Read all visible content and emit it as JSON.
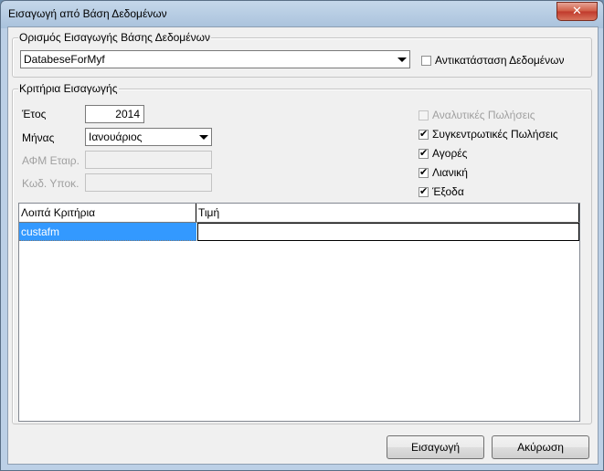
{
  "window": {
    "title": "Εισαγωγή από Βάση Δεδομένων"
  },
  "db_group": {
    "label": "Ορισμός Εισαγωγής Βάσης Δεδομένων",
    "database_value": "DatabeseForMyf",
    "replace_label": "Αντικατάσταση Δεδομένων",
    "replace_checked": false
  },
  "criteria_group": {
    "label": "Κριτήρια Εισαγωγής",
    "year_label": "Έτος",
    "year_value": "2014",
    "month_label": "Μήνας",
    "month_value": "Ιανουάριος",
    "afm_label": "ΑΦΜ Εταιρ.",
    "afm_value": "",
    "branch_label": "Κωδ. Υποκ.",
    "branch_value": "",
    "checkboxes": [
      {
        "label": "Αναλυτικές Πωλήσεις",
        "checked": false,
        "enabled": false
      },
      {
        "label": "Συγκεντρωτικές Πωλήσεις",
        "checked": true,
        "enabled": true
      },
      {
        "label": "Αγορές",
        "checked": true,
        "enabled": true
      },
      {
        "label": "Λιανική",
        "checked": true,
        "enabled": true
      },
      {
        "label": "Έξοδα",
        "checked": true,
        "enabled": true
      }
    ]
  },
  "grid": {
    "columns": [
      "Λοιπά Κριτήρια",
      "Τιμή"
    ],
    "rows": [
      {
        "criterion": "custafm",
        "value": ""
      }
    ]
  },
  "buttons": {
    "import_label": "Εισαγωγή",
    "cancel_label": "Ακύρωση"
  }
}
